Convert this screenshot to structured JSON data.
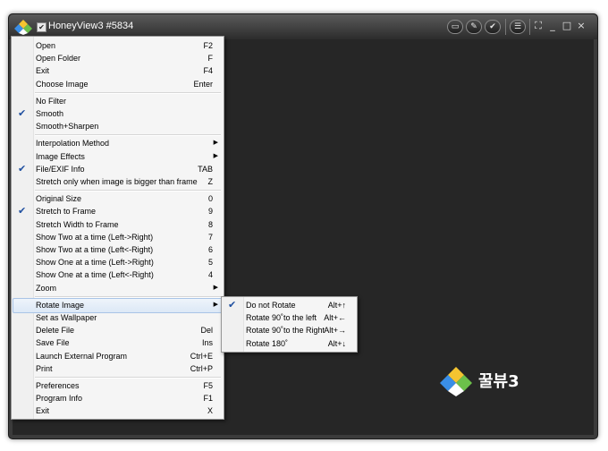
{
  "window": {
    "title": "HoneyView3 #5834"
  },
  "titlebar_buttons": [
    "window-mode-icon",
    "pen-icon",
    "check-icon",
    "list-icon",
    "fullscreen-icon"
  ],
  "window_controls": [
    "_",
    "□",
    "×"
  ],
  "brand": {
    "text": "꿀뷰3"
  },
  "colors": {
    "window_bg": "#3b3b3b",
    "viewer_bg": "#262626",
    "menu_bg": "#f5f5f5",
    "highlight": "#dce8f6",
    "check": "#2050a0"
  },
  "menu": {
    "items": [
      {
        "label": "Open",
        "shortcut": "F2",
        "checked": false,
        "submenu": false
      },
      {
        "label": "Open Folder",
        "shortcut": "F",
        "checked": false,
        "submenu": false
      },
      {
        "label": "Exit",
        "shortcut": "F4",
        "checked": false,
        "submenu": false
      },
      {
        "label": "Choose Image",
        "shortcut": "Enter",
        "checked": false,
        "submenu": false
      },
      {
        "label": "No Filter",
        "shortcut": "",
        "checked": false,
        "submenu": false
      },
      {
        "label": "Smooth",
        "shortcut": "",
        "checked": true,
        "submenu": false
      },
      {
        "label": "Smooth+Sharpen",
        "shortcut": "",
        "checked": false,
        "submenu": false
      },
      {
        "label": "Interpolation Method",
        "shortcut": "",
        "checked": false,
        "submenu": true
      },
      {
        "label": "Image Effects",
        "shortcut": "",
        "checked": false,
        "submenu": true
      },
      {
        "label": "File/EXIF Info",
        "shortcut": "TAB",
        "checked": true,
        "submenu": false
      },
      {
        "label": "Stretch only when image is bigger than frame",
        "shortcut": "Z",
        "checked": false,
        "submenu": false
      },
      {
        "label": "Original Size",
        "shortcut": "0",
        "checked": false,
        "submenu": false
      },
      {
        "label": "Stretch to Frame",
        "shortcut": "9",
        "checked": true,
        "submenu": false
      },
      {
        "label": "Stretch Width to Frame",
        "shortcut": "8",
        "checked": false,
        "submenu": false
      },
      {
        "label": "Show Two at a time (Left->Right)",
        "shortcut": "7",
        "checked": false,
        "submenu": false
      },
      {
        "label": "Show Two at a time (Left<-Right)",
        "shortcut": "6",
        "checked": false,
        "submenu": false
      },
      {
        "label": "Show One at a time (Left->Right)",
        "shortcut": "5",
        "checked": false,
        "submenu": false
      },
      {
        "label": "Show One at a time (Left<-Right)",
        "shortcut": "4",
        "checked": false,
        "submenu": false
      },
      {
        "label": "Zoom",
        "shortcut": "",
        "checked": false,
        "submenu": true
      },
      {
        "label": "Rotate Image",
        "shortcut": "",
        "checked": false,
        "submenu": true,
        "highlighted": true
      },
      {
        "label": "Set as Wallpaper",
        "shortcut": "",
        "checked": false,
        "submenu": false
      },
      {
        "label": "Delete File",
        "shortcut": "Del",
        "checked": false,
        "submenu": false
      },
      {
        "label": "Save File",
        "shortcut": "Ins",
        "checked": false,
        "submenu": false
      },
      {
        "label": "Launch External Program",
        "shortcut": "Ctrl+E",
        "checked": false,
        "submenu": false
      },
      {
        "label": "Print",
        "shortcut": "Ctrl+P",
        "checked": false,
        "submenu": false
      },
      {
        "label": "Preferences",
        "shortcut": "F5",
        "checked": false,
        "submenu": false
      },
      {
        "label": "Program Info",
        "shortcut": "F1",
        "checked": false,
        "submenu": false
      },
      {
        "label": "Exit",
        "shortcut": "X",
        "checked": false,
        "submenu": false
      }
    ]
  },
  "submenu": {
    "items": [
      {
        "label": "Do not Rotate",
        "shortcut": "Alt+↑",
        "checked": true
      },
      {
        "label": "Rotate 90˚to the left",
        "shortcut": "Alt+←",
        "checked": false
      },
      {
        "label": "Rotate 90˚to the Right",
        "shortcut": "Alt+→",
        "checked": false
      },
      {
        "label": "Rotate 180˚",
        "shortcut": "Alt+↓",
        "checked": false
      }
    ]
  }
}
